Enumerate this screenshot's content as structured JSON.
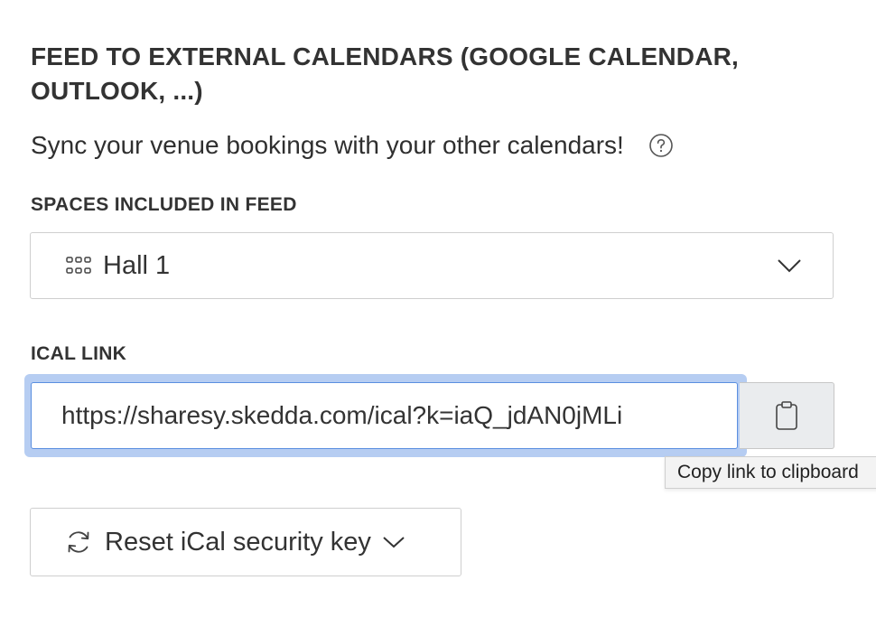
{
  "feed": {
    "title": "FEED TO EXTERNAL CALENDARS (GOOGLE CALENDAR, OUTLOOK, ...)",
    "subtitle": "Sync your venue bookings with your other calendars!",
    "help_icon": "question-circle-icon"
  },
  "spaces": {
    "label": "SPACES INCLUDED IN FEED",
    "selected": "Hall 1",
    "icon": "grid-icon",
    "dropdown_icon": "chevron-down-icon"
  },
  "ical": {
    "label": "ICAL LINK",
    "value": "https://sharesy.skedda.com/ical?k=iaQ_jdAN0jMLi",
    "copy_icon": "clipboard-icon",
    "tooltip": "Copy link to clipboard",
    "focus_color": "#5b8fe0"
  },
  "reset": {
    "label": "Reset iCal security key",
    "icon": "refresh-icon",
    "dropdown_icon": "chevron-down-icon"
  }
}
